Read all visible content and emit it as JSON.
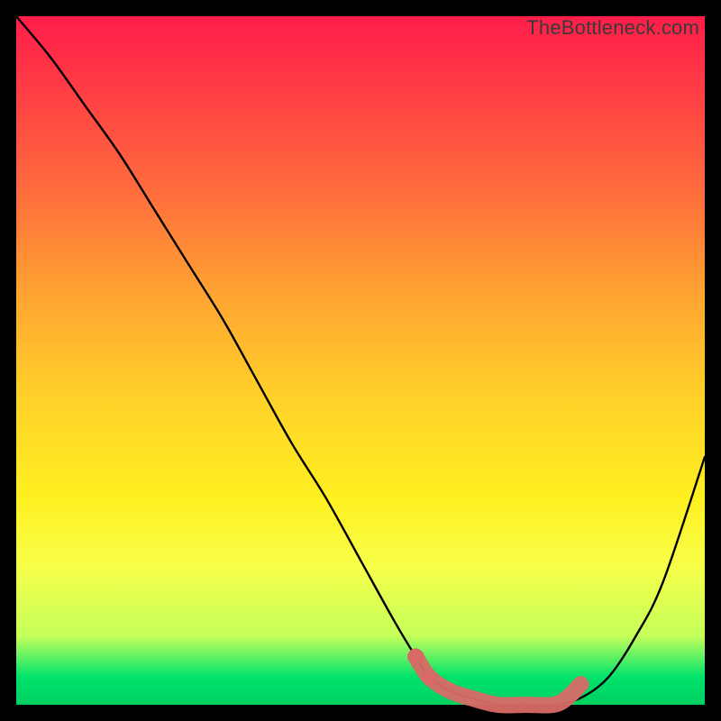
{
  "watermark": "TheBottleneck.com",
  "chart_data": {
    "type": "line",
    "title": "",
    "xlabel": "",
    "ylabel": "",
    "xlim": [
      0,
      100
    ],
    "ylim": [
      0,
      100
    ],
    "series": [
      {
        "name": "bottleneck-curve",
        "x": [
          0,
          5,
          10,
          15,
          20,
          25,
          30,
          35,
          40,
          45,
          50,
          55,
          58,
          60,
          63,
          66,
          70,
          74,
          78,
          82,
          86,
          90,
          94,
          100
        ],
        "y": [
          100,
          94,
          87,
          80,
          72,
          64,
          56,
          47,
          38,
          30,
          21,
          12,
          7,
          4,
          2,
          1,
          0,
          0,
          0,
          1,
          4,
          10,
          18,
          36
        ]
      },
      {
        "name": "highlight-band",
        "x": [
          58,
          60,
          63,
          66,
          70,
          74,
          78,
          80,
          82
        ],
        "y": [
          7,
          4,
          2,
          1,
          0,
          0,
          0,
          1,
          3
        ]
      }
    ],
    "colors": {
      "curve": "#000000",
      "highlight": "#d86a66"
    }
  }
}
